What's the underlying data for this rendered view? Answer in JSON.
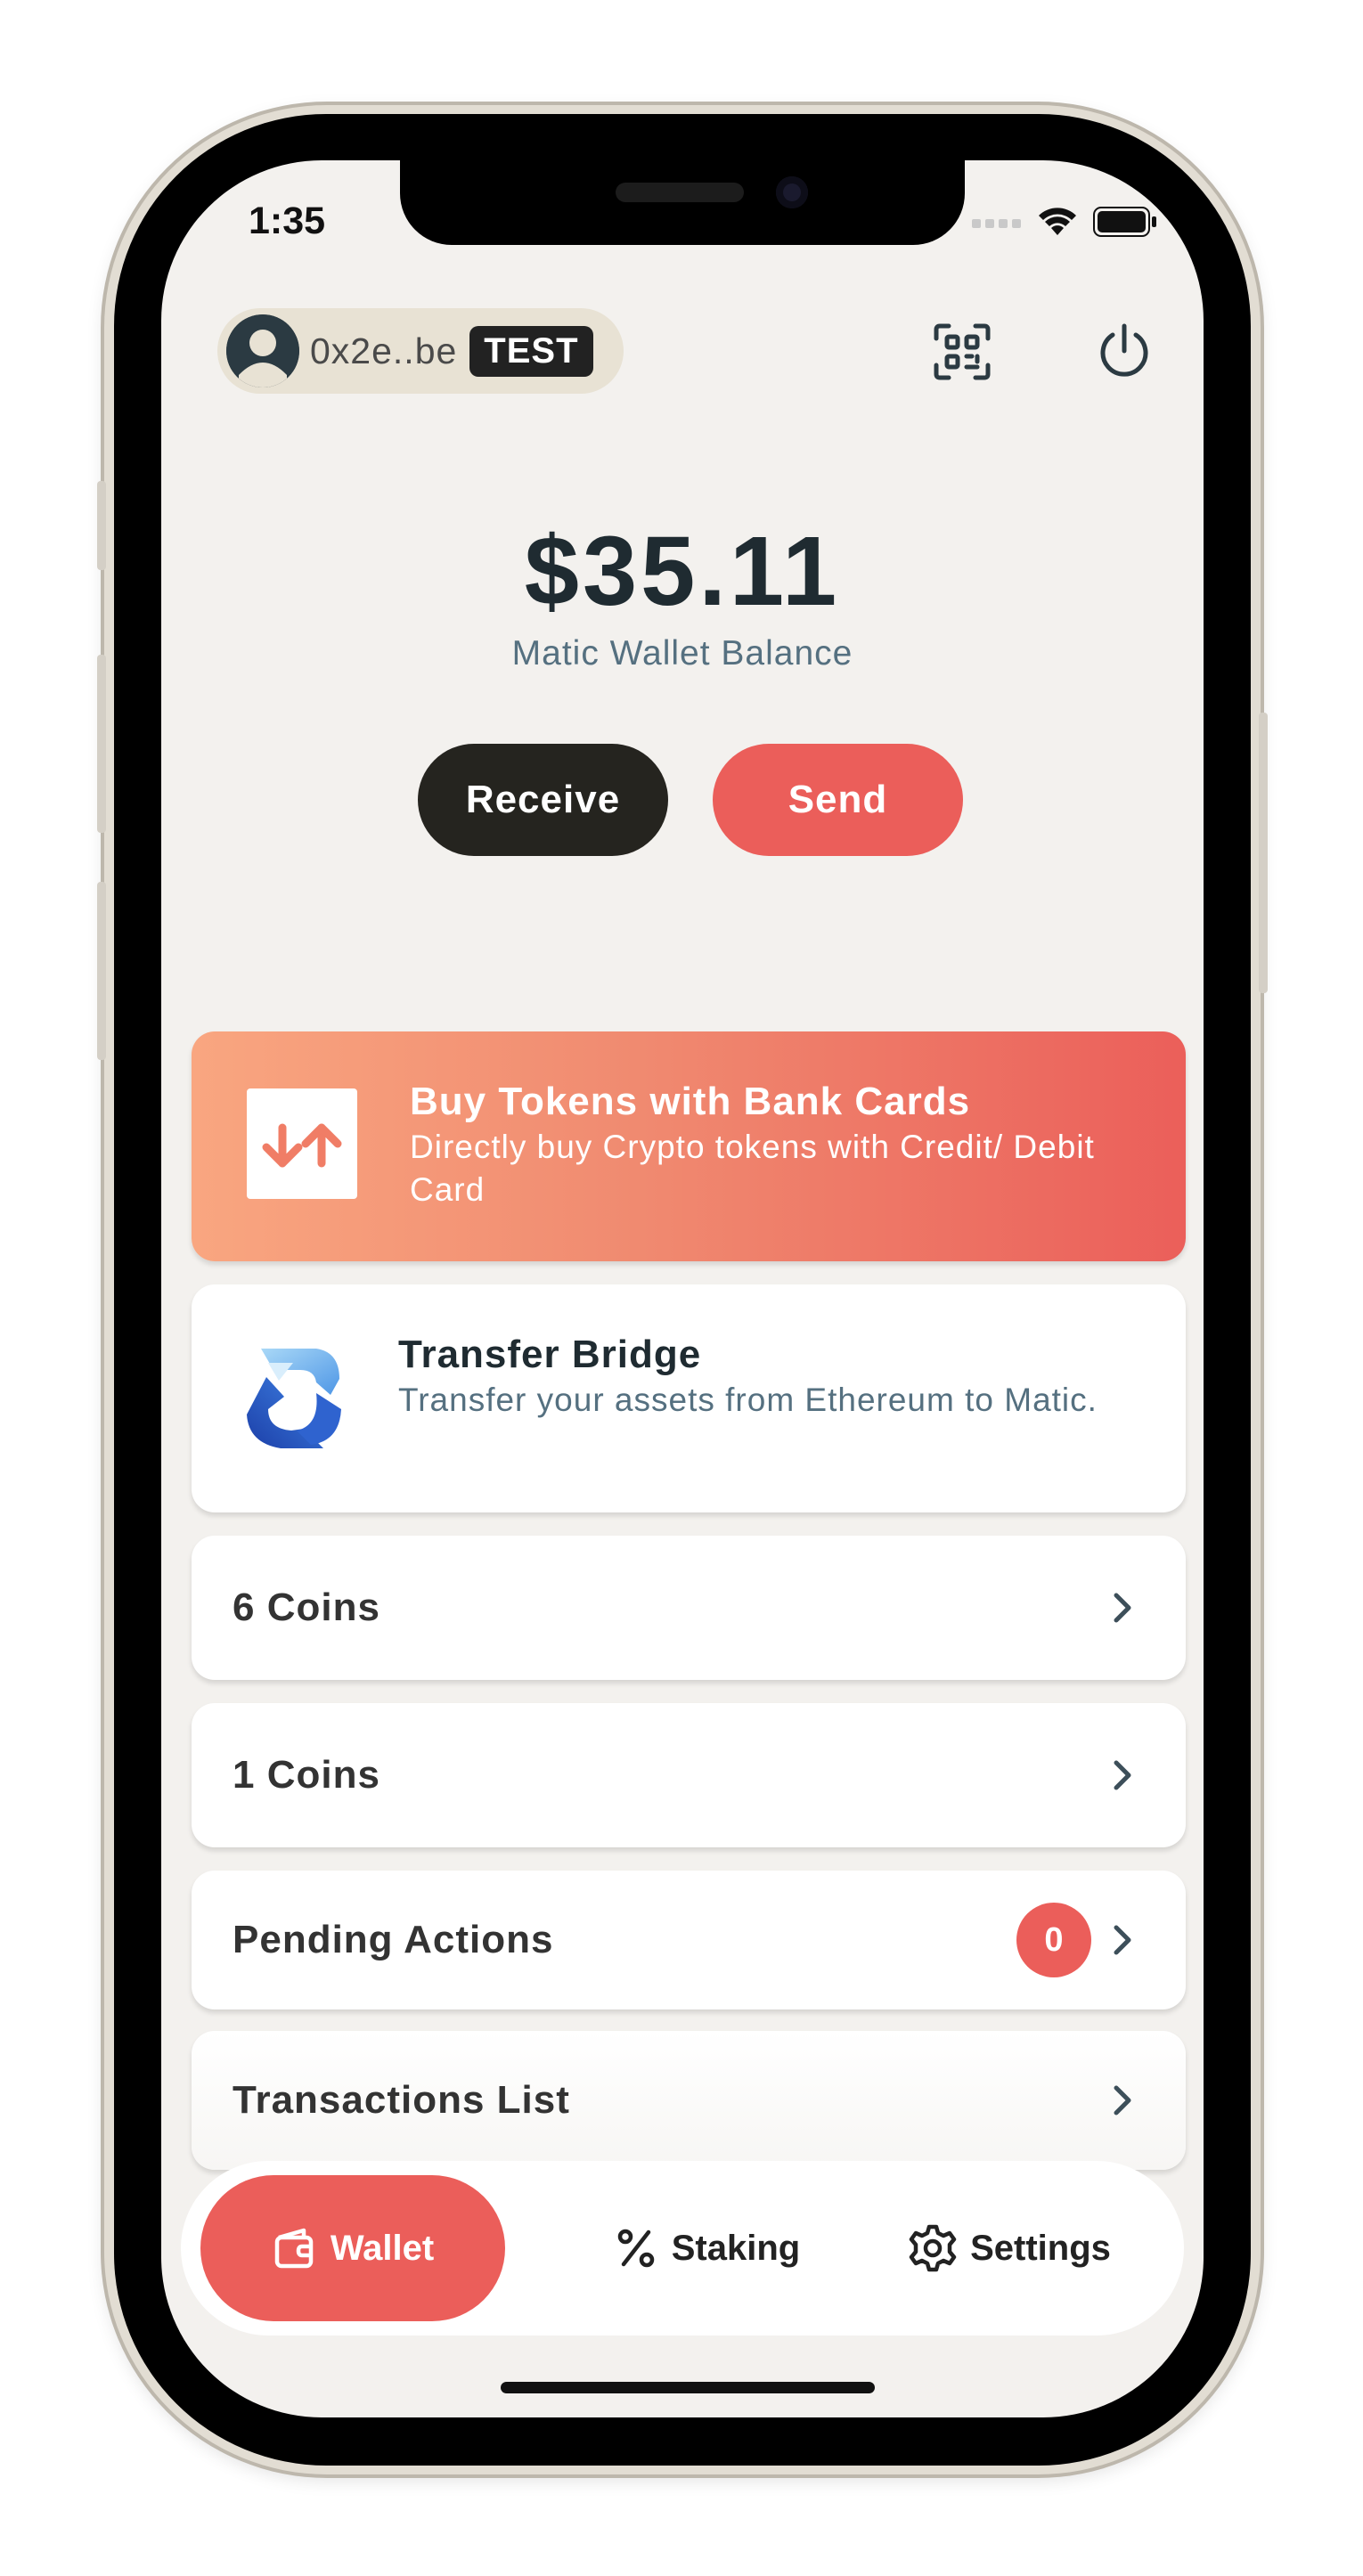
{
  "status_bar": {
    "time": "1:35"
  },
  "header": {
    "address": "0x2e..be",
    "network_badge": "TEST"
  },
  "balance": {
    "amount": "$35.11",
    "label": "Matic Wallet Balance"
  },
  "actions": {
    "receive_label": "Receive",
    "send_label": "Send"
  },
  "cards": {
    "buy": {
      "title": "Buy Tokens with Bank Cards",
      "description": "Directly buy Crypto tokens with Credit/ Debit Card"
    },
    "bridge": {
      "title": "Transfer Bridge",
      "description": "Transfer your assets from Ethereum to Matic."
    }
  },
  "rows": [
    {
      "label": "6 Coins"
    },
    {
      "label": "1 Coins"
    },
    {
      "label": "Pending Actions",
      "badge": "0"
    },
    {
      "label": "Transactions List"
    }
  ],
  "bottom_nav": {
    "items": [
      {
        "label": "Wallet",
        "icon": "wallet-icon",
        "active": true
      },
      {
        "label": "Staking",
        "icon": "percent-icon",
        "active": false
      },
      {
        "label": "Settings",
        "icon": "gear-icon",
        "active": false
      }
    ]
  },
  "colors": {
    "accent": "#eb5e5a",
    "dark": "#25241f",
    "background": "#f3f1ee",
    "text_secondary": "#557080"
  }
}
